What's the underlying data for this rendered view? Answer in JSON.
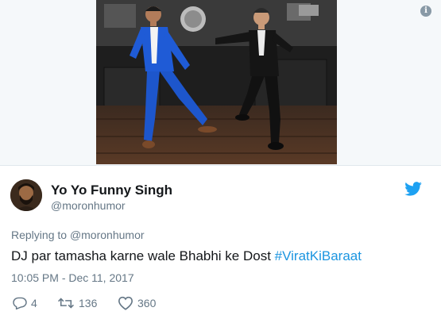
{
  "media": {
    "info_icon": "info-icon",
    "photo_icon": "photo"
  },
  "tweet": {
    "display_name": "Yo Yo Funny Singh",
    "handle": "@moronhumor",
    "replying_prefix": "Replying to ",
    "replying_to": "@moronhumor",
    "text": "DJ par tamasha karne wale Bhabhi ke Dost ",
    "hashtag": "#ViratKiBaraat",
    "timestamp": "10:05 PM - Dec 11, 2017",
    "brand_icon": "twitter-bird-icon"
  },
  "actions": {
    "reply_count": "4",
    "retweet_count": "136",
    "like_count": "360"
  },
  "colors": {
    "link": "#1b95e0",
    "secondary_text": "#657786",
    "primary_text": "#14171a",
    "media_background": "#f5f8fa"
  }
}
